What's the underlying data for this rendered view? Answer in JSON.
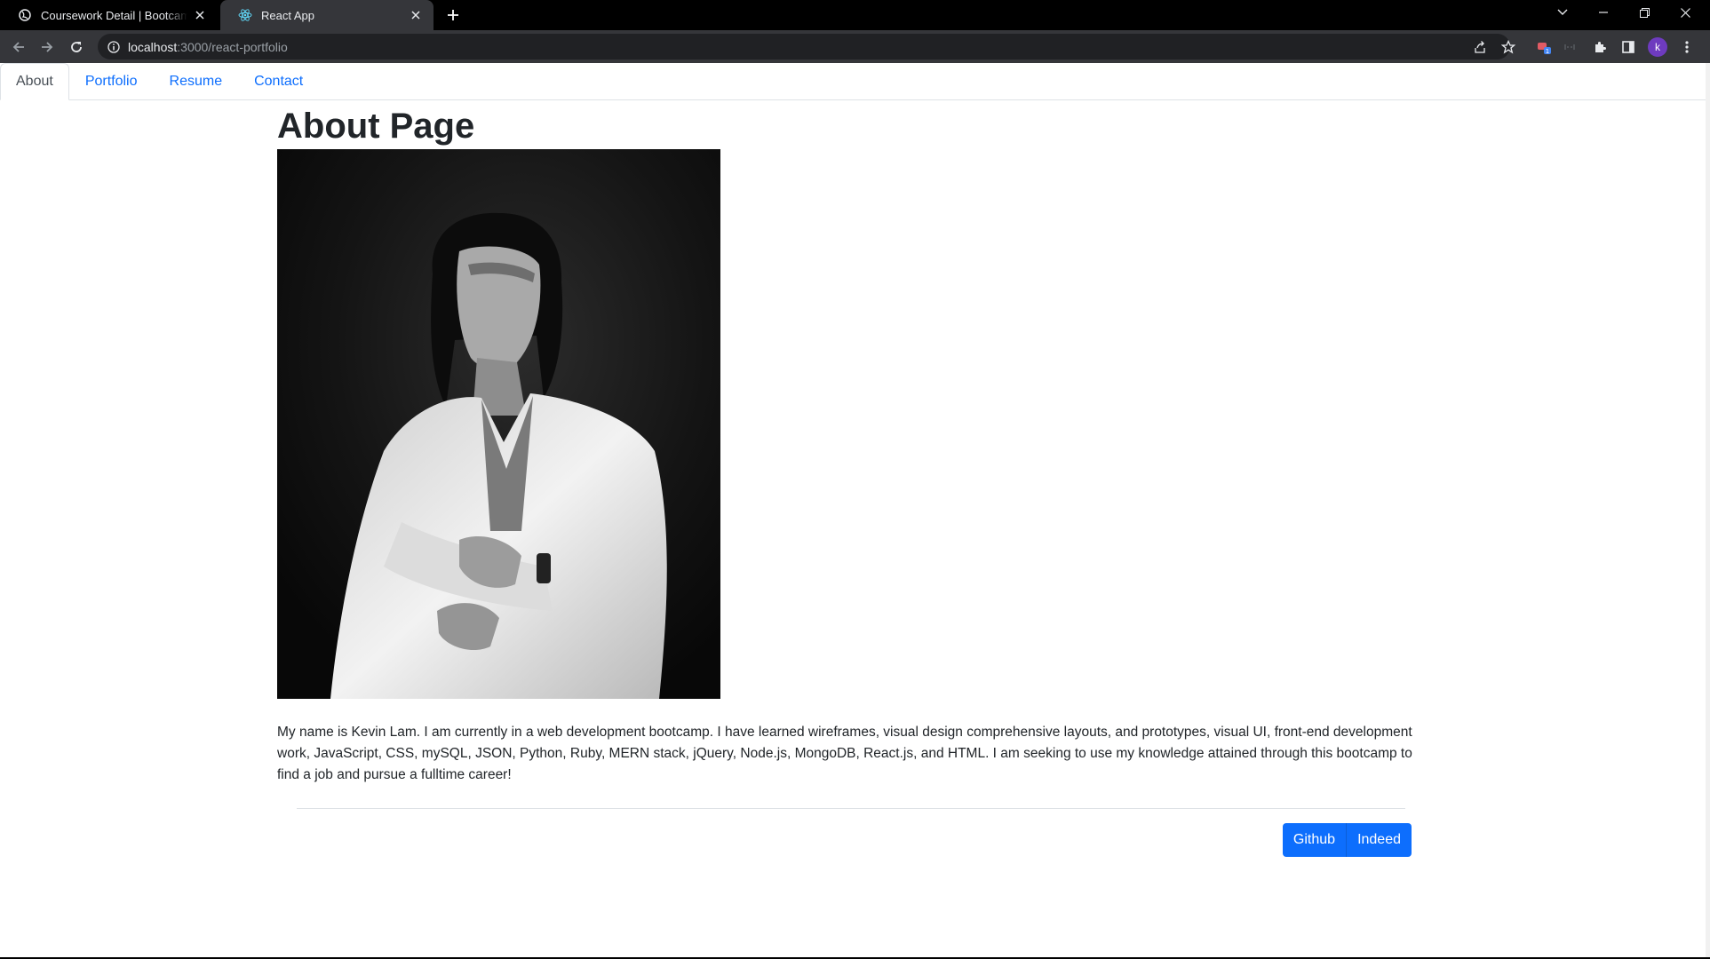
{
  "browser": {
    "tabs": [
      {
        "title": "Coursework Detail | Bootcamp Spot",
        "active": false
      },
      {
        "title": "React App",
        "active": true
      }
    ],
    "url_host": "localhost",
    "url_path": ":3000/react-portfolio",
    "profile_initial": "k",
    "extension_badge": "1"
  },
  "nav": {
    "tabs": [
      {
        "label": "About",
        "active": true
      },
      {
        "label": "Portfolio",
        "active": false
      },
      {
        "label": "Resume",
        "active": false
      },
      {
        "label": "Contact",
        "active": false
      }
    ]
  },
  "page": {
    "title": "About Page",
    "bio": "My name is Kevin Lam. I am currently in a web development bootcamp. I have learned wireframes, visual design comprehensive layouts, and prototypes, visual UI, front-end development work, JavaScript, CSS, mySQL, JSON, Python, Ruby, MERN stack, jQuery, Node.js, MongoDB, React.js, and HTML. I am seeking to use my knowledge attained through this bootcamp to find a job and pursue a fulltime career!",
    "buttons": {
      "github": "Github",
      "indeed": "Indeed"
    }
  },
  "colors": {
    "primary": "#0d6efd",
    "text": "#212529",
    "chrome_dark": "#35363a"
  }
}
